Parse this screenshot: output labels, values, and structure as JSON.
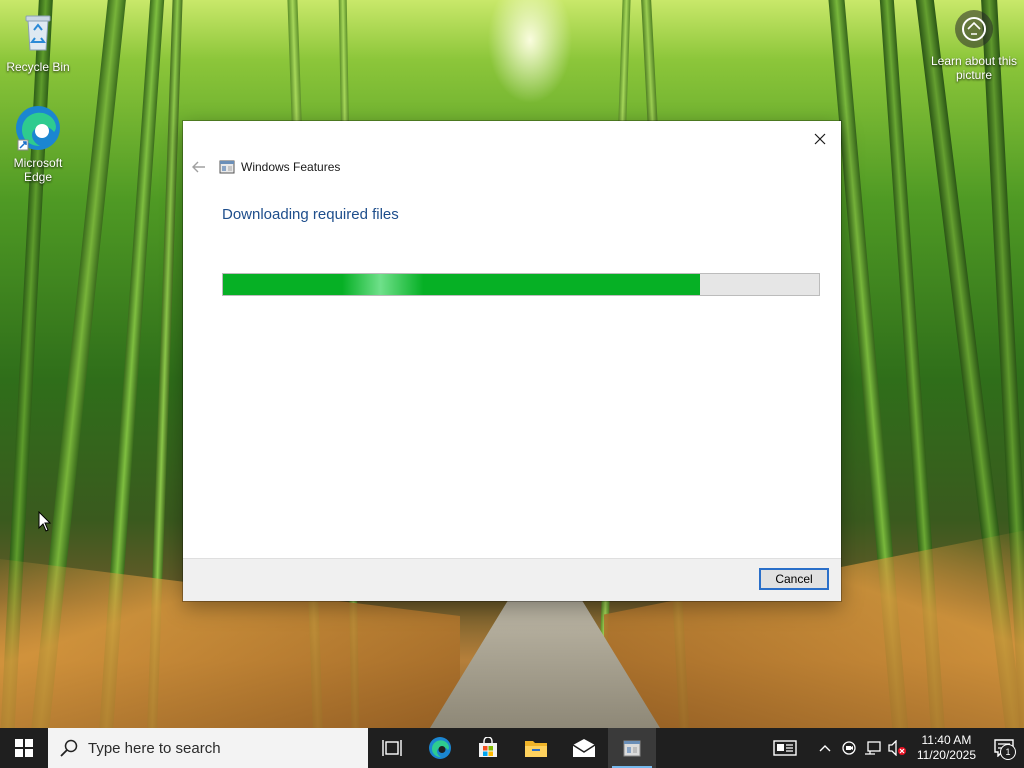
{
  "desktop": {
    "icons": [
      {
        "label": "Recycle Bin"
      },
      {
        "label": "Microsoft Edge"
      }
    ],
    "learn_picture": {
      "label": "Learn about this picture"
    }
  },
  "dialog": {
    "app_title": "Windows Features",
    "heading": "Downloading required files",
    "progress_percent": 80,
    "cancel_label": "Cancel",
    "colors": {
      "heading": "#1e4e8c",
      "progress_fill": "#06b025",
      "button_border": "#2a6fc9"
    }
  },
  "taskbar": {
    "search_placeholder": "Type here to search",
    "apps": [
      {
        "name": "task-view-icon"
      },
      {
        "name": "edge-icon"
      },
      {
        "name": "store-icon"
      },
      {
        "name": "file-explorer-icon"
      },
      {
        "name": "mail-icon"
      },
      {
        "name": "windows-features-icon",
        "active": true
      }
    ],
    "tray": {
      "time": "11:40 AM",
      "date": "11/20/2025",
      "notification_count": "1"
    }
  }
}
